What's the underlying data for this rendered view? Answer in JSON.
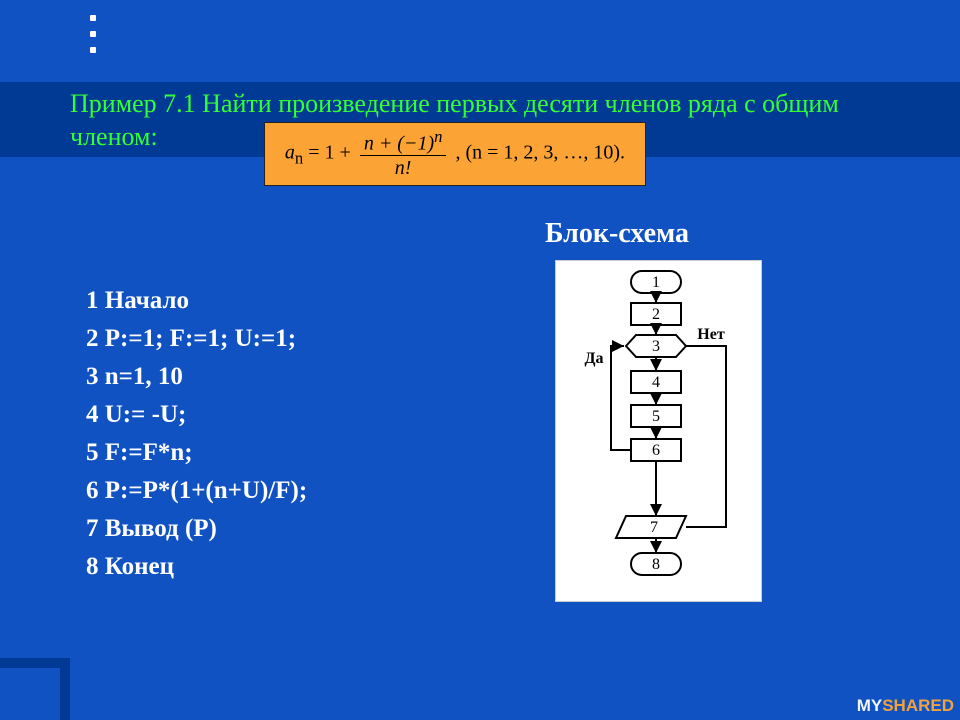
{
  "title": "Пример 7.1  Найти произведение первых десяти членов ряда с общим членом:",
  "formula": {
    "lhs_var": "a",
    "lhs_sub": "n",
    "equals": " = 1 + ",
    "num_text": "n + (−1)",
    "num_sup": "n",
    "den_text": "n!",
    "tail": " ,    (n = 1, 2, 3, …, 10)."
  },
  "diagram_title": "Блок-схема",
  "steps": [
    "1  Начало",
    "2  P:=1; F:=1; U:=1;",
    "3  n=1, 10",
    "4  U:= -U;",
    "5  F:=F*n;",
    "6  P:=P*(1+(n+U)/F);",
    "7 Вывод  (P)",
    "8  Конец"
  ],
  "flow": {
    "labels": {
      "yes": "Да",
      "no": "Нет"
    },
    "nodes": [
      "1",
      "2",
      "3",
      "4",
      "5",
      "6",
      "7",
      "8"
    ]
  },
  "watermark": {
    "a": "MY",
    "b": "SHARED"
  }
}
